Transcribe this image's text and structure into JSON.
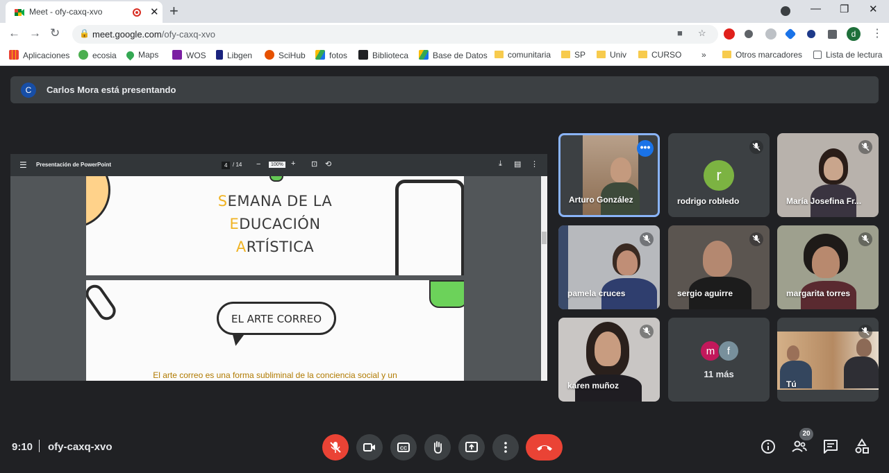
{
  "browser": {
    "tab_title": "Meet - ofy-caxq-xvo",
    "url_host": "meet.google.com",
    "url_path": "/ofy-caxq-xvo",
    "bookmarks": [
      {
        "label": "Aplicaciones",
        "icon": "apps-grid-icon"
      },
      {
        "label": "ecosia",
        "icon": "ecosia-icon"
      },
      {
        "label": "Maps",
        "icon": "maps-pin-icon"
      },
      {
        "label": "WOS",
        "icon": "wos-icon"
      },
      {
        "label": "Libgen",
        "icon": "libgen-icon"
      },
      {
        "label": "SciHub",
        "icon": "scihub-icon"
      },
      {
        "label": "fotos",
        "icon": "drive-icon"
      },
      {
        "label": "Biblioteca",
        "icon": "library-icon"
      },
      {
        "label": "Base de Datos",
        "icon": "drive-icon"
      },
      {
        "label": "comunitaria",
        "icon": "folder-icon"
      },
      {
        "label": "SP",
        "icon": "folder-icon"
      },
      {
        "label": "Univ",
        "icon": "folder-icon"
      },
      {
        "label": "CURSO",
        "icon": "folder-icon"
      }
    ],
    "overflow_chevron": "»",
    "other_bookmarks": "Otros marcadores",
    "reading_list": "Lista de lectura",
    "profile_initial": "d"
  },
  "meet": {
    "presenting_initial": "C",
    "presenting_banner": "Carlos Mora está presentando",
    "pdf_viewer": {
      "title": "Presentación de PowerPoint",
      "page_current": "4",
      "page_total": "/ 14",
      "zoom": "100%"
    },
    "slide": {
      "title_lines": [
        {
          "cap": "S",
          "rest": "EMANA DE LA"
        },
        {
          "cap": "E",
          "rest": "DUCACIÓN"
        },
        {
          "cap": "A",
          "rest": "RTÍSTICA"
        }
      ],
      "bubble_text": "EL ARTE CORREO",
      "body_text": "El arte correo es una forma subliminal de la conciencia social y un"
    },
    "participants": [
      {
        "name": "Arturo González",
        "muted": false,
        "active_speaker": true
      },
      {
        "name": "rodrigo robledo",
        "muted": true,
        "initial": "r"
      },
      {
        "name": "María Josefina Fr...",
        "muted": true
      },
      {
        "name": "pamela cruces",
        "muted": true
      },
      {
        "name": "sergio aguirre",
        "muted": true
      },
      {
        "name": "margarita torres",
        "muted": true
      },
      {
        "name": "karen muñoz",
        "muted": true
      },
      {
        "name": "11 más",
        "muted": false,
        "initials": [
          "m",
          "f"
        ]
      },
      {
        "name": "Tú",
        "muted": true
      }
    ],
    "bottom_bar": {
      "time": "9:10",
      "meeting_code": "ofy-caxq-xvo",
      "participants_count": "20"
    }
  },
  "colors": {
    "accent_blue": "#8ab4f8",
    "hangup_red": "#ea4335",
    "meet_bg": "#202124",
    "slide_caps": "#f0b323"
  }
}
